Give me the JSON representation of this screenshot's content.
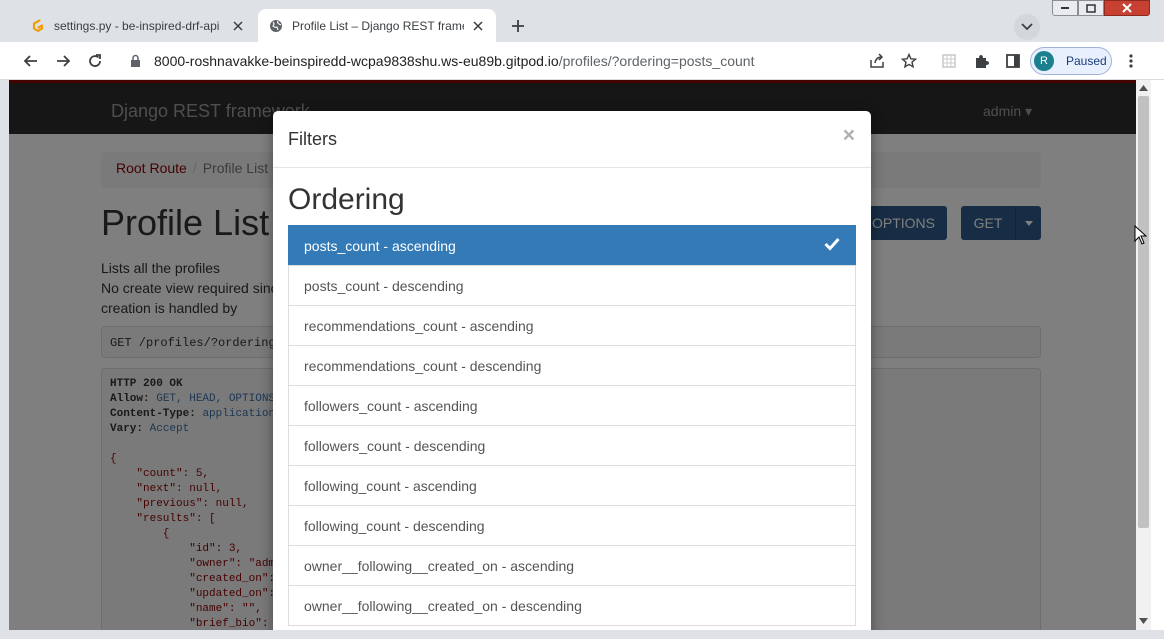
{
  "browser": {
    "tabs": [
      {
        "title": "settings.py - be-inspired-drf-api",
        "icon": "gitpod-icon",
        "active": false
      },
      {
        "title": "Profile List – Django REST framew",
        "icon": "globe-icon",
        "active": true
      }
    ],
    "url_host": "8000-roshnavakke-beinspiredd-wcpa9838shu.ws-eu89b.gitpod.io",
    "url_path": "/profiles/?ordering=posts_count",
    "profile_initial": "R",
    "profile_status": "Paused"
  },
  "page": {
    "brand": "Django REST framework",
    "user_menu": "admin",
    "breadcrumbs": [
      "Root Route",
      "Profile List"
    ],
    "heading": "Profile List",
    "description": "Lists all the profiles\nNo create view required since profile creation is handled by\nDjango signals.",
    "options_label": "OPTIONS",
    "get_label": "GET",
    "request_line": "GET /profiles/?ordering=posts_count",
    "response": {
      "status": "HTTP 200 OK",
      "allow_label": "Allow:",
      "allow_value": "GET, HEAD, OPTIONS",
      "content_type_label": "Content-Type:",
      "content_type_value": "application/json",
      "vary_label": "Vary:",
      "vary_value": "Accept",
      "body_lines": [
        "{",
        "    \"count\": 5,",
        "    \"next\": null,",
        "    \"previous\": null,",
        "    \"results\": [",
        "        {",
        "            \"id\": 3,",
        "            \"owner\": \"admin\",",
        "            \"created_on\": \"",
        "            \"updated_on\": \"",
        "            \"name\": \"\",",
        "            \"brief_bio\": \""
      ]
    }
  },
  "modal": {
    "title": "Filters",
    "close": "×",
    "section": "Ordering",
    "options": [
      {
        "label": "posts_count - ascending",
        "selected": true
      },
      {
        "label": "posts_count - descending",
        "selected": false
      },
      {
        "label": "recommendations_count - ascending",
        "selected": false
      },
      {
        "label": "recommendations_count - descending",
        "selected": false
      },
      {
        "label": "followers_count - ascending",
        "selected": false
      },
      {
        "label": "followers_count - descending",
        "selected": false
      },
      {
        "label": "following_count - ascending",
        "selected": false
      },
      {
        "label": "following_count - descending",
        "selected": false
      },
      {
        "label": "owner__following__created_on - ascending",
        "selected": false
      },
      {
        "label": "owner__following__created_on - descending",
        "selected": false
      }
    ]
  },
  "colors": {
    "selected": "#337ab7",
    "navbar": "#2c2c2c",
    "accent": "#8b0000"
  }
}
